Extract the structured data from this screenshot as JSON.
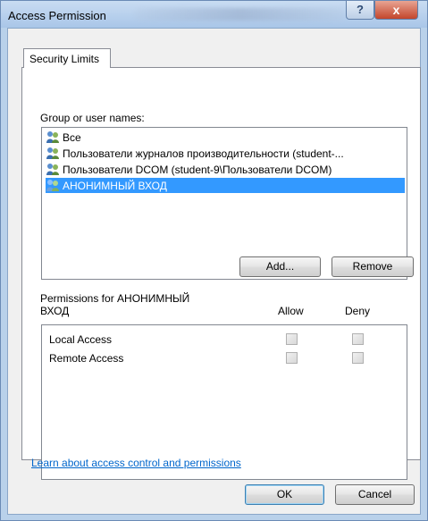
{
  "window": {
    "title": "Access Permission",
    "help_label": "?",
    "close_label": "x"
  },
  "tabs": [
    {
      "label": "Security Limits"
    }
  ],
  "groups": {
    "label": "Group or user names:",
    "items": [
      {
        "name": "Все",
        "icon": "users-group-icon",
        "selected": false
      },
      {
        "name": "Пользователи журналов производительности (student-...",
        "icon": "users-group-icon",
        "selected": false
      },
      {
        "name": "Пользователи DCOM (student-9\\Пользователи DCOM)",
        "icon": "users-group-icon",
        "selected": false
      },
      {
        "name": "АНОНИМНЫЙ ВХОД",
        "icon": "users-group-icon",
        "selected": true
      }
    ],
    "add_label": "Add...",
    "remove_label": "Remove"
  },
  "permissions": {
    "header_line1": "Permissions for АНОНИМНЫЙ",
    "header_line2": "ВХОД",
    "allow_label": "Allow",
    "deny_label": "Deny",
    "rows": [
      {
        "name": "Local Access",
        "allow": false,
        "deny": false
      },
      {
        "name": "Remote Access",
        "allow": false,
        "deny": false
      }
    ]
  },
  "link_text": "Learn about access control and permissions",
  "footer": {
    "ok_label": "OK",
    "cancel_label": "Cancel"
  },
  "colors": {
    "selection": "#3399ff",
    "link": "#0066cc",
    "frame": "#b9d1ea",
    "close": "#c3462c"
  }
}
